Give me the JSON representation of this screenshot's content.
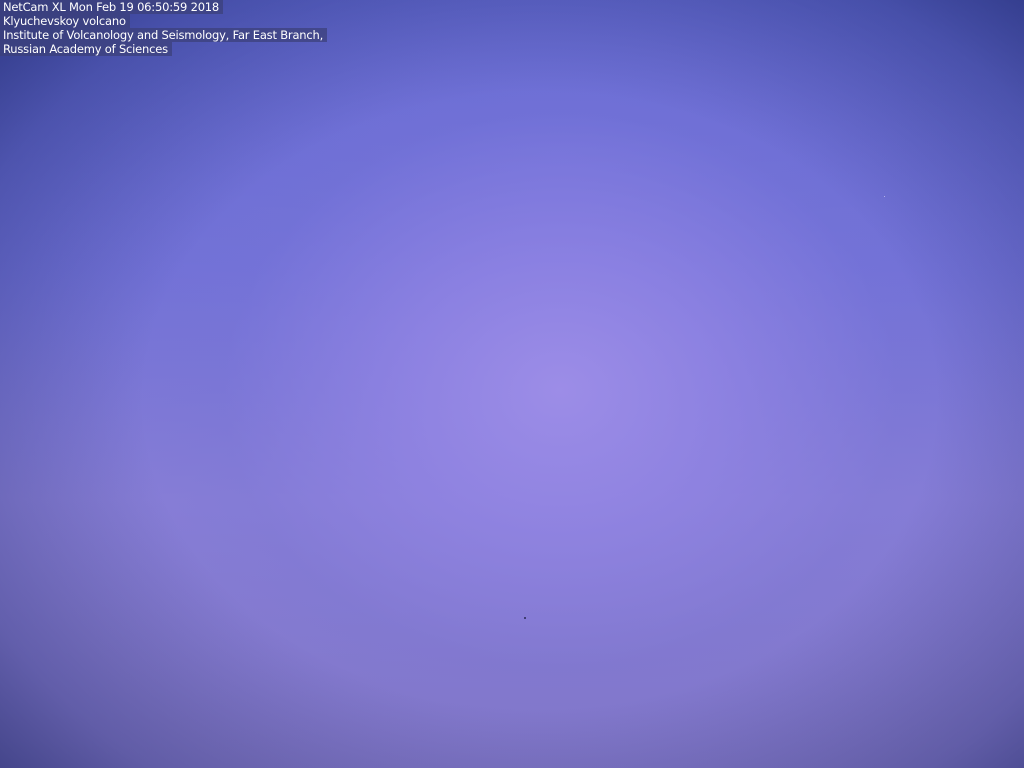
{
  "overlay": {
    "lines": [
      "NetCam XL Mon Feb 19 06:50:59 2018",
      "Klyuchevskoy volcano",
      "Institute of Volcanology and Seismology, Far East Branch,",
      "Russian Academy of Sciences"
    ]
  },
  "colors": {
    "sky_center": "#9e8ee8",
    "sky_edge": "#4a58b8",
    "caption_background": "#3c4078",
    "caption_text": "#ffffff"
  }
}
